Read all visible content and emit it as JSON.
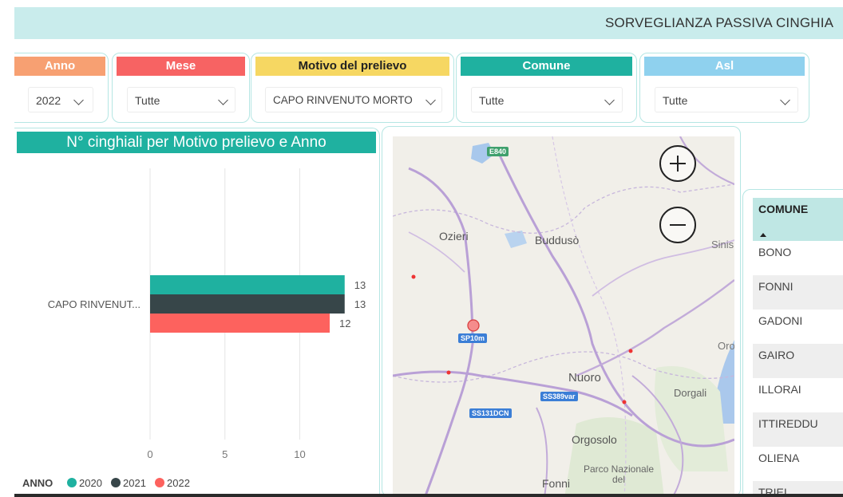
{
  "header": {
    "title": "SORVEGLIANZA PASSIVA CINGHIA"
  },
  "filters": [
    {
      "label": "Anno",
      "value": "2022",
      "color": "#f7a072"
    },
    {
      "label": "Mese",
      "value": "Tutte",
      "color": "#f76363"
    },
    {
      "label": "Motivo del prelievo",
      "value": "CAPO RINVENUTO MORTO",
      "color": "#f6d762"
    },
    {
      "label": "Comune",
      "value": "Tutte",
      "color": "#1fb1a0"
    },
    {
      "label": "Asl",
      "value": "Tutte",
      "color": "#8fd1ee"
    }
  ],
  "chart": {
    "title": "N° cinghiali per Motivo prelievo e Anno",
    "legend_title": "ANNO"
  },
  "chart_data": {
    "type": "bar",
    "orientation": "horizontal",
    "categories": [
      "CAPO RINVENUT..."
    ],
    "series": [
      {
        "name": "2020",
        "values": [
          13
        ],
        "color": "#1fb1a0"
      },
      {
        "name": "2021",
        "values": [
          13
        ],
        "color": "#374649"
      },
      {
        "name": "2022",
        "values": [
          12
        ],
        "color": "#fd625e"
      }
    ],
    "xticks": [
      "0",
      "5",
      "10"
    ],
    "xlim": [
      0,
      13.8
    ],
    "grid": true,
    "legend_position": "bottom-left"
  },
  "map": {
    "labels": [
      "Ozieri",
      "Buddusò",
      "Sinis",
      "Nuoro",
      "Dorgali",
      "Orgosolo",
      "Fonni",
      "Parco Nazionale del",
      "Oro"
    ],
    "road_badges": [
      "E840",
      "SP10m",
      "SS389var",
      "SS131DCN"
    ],
    "zoom_in_icon": "plus-circle-icon",
    "zoom_out_icon": "minus-circle-icon"
  },
  "table": {
    "column": "COMUNE",
    "sort": "ascending",
    "rows": [
      "BONO",
      "FONNI",
      "GADONI",
      "GAIRO",
      "ILLORAI",
      "ITTIREDDU",
      "OLIENA",
      "TRIEI"
    ]
  }
}
